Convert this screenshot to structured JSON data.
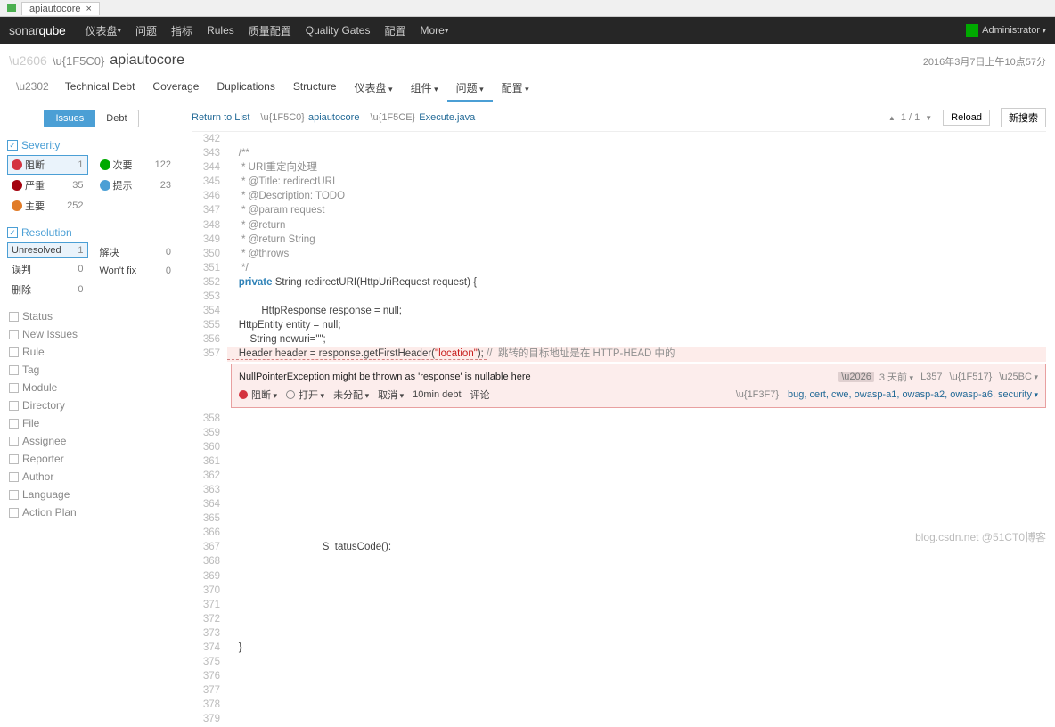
{
  "browser": {
    "tab_title": "apiautocore",
    "close": "×"
  },
  "nav": {
    "logo_a": "sonar",
    "logo_b": "qube",
    "items": [
      "仪表盘",
      "问题",
      "指标",
      "Rules",
      "质量配置",
      "Quality Gates",
      "配置",
      "More"
    ],
    "admin": "Administrator"
  },
  "project": {
    "name": "apiautocore",
    "timestamp": "2016年3月7日上午10点57分",
    "tabs": [
      "Technical Debt",
      "Coverage",
      "Duplications",
      "Structure",
      "仪表盘",
      "组件",
      "问题",
      "配置"
    ],
    "active_tab": 6
  },
  "sidebar": {
    "tabs": {
      "issues": "Issues",
      "debt": "Debt"
    },
    "severity": {
      "title": "Severity",
      "left": [
        {
          "icon": "sev-red",
          "label": "阻断",
          "count": "1",
          "sel": true
        },
        {
          "icon": "sev-darkred",
          "label": "严重",
          "count": "35"
        },
        {
          "icon": "sev-orange",
          "label": "主要",
          "count": "252"
        }
      ],
      "right": [
        {
          "icon": "sev-green",
          "label": "次要",
          "count": "122"
        },
        {
          "icon": "sev-cyan",
          "label": "提示",
          "count": "23"
        }
      ]
    },
    "resolution": {
      "title": "Resolution",
      "left": [
        {
          "label": "Unresolved",
          "count": "1",
          "sel": true
        },
        {
          "label": "误判",
          "count": "0"
        },
        {
          "label": "删除",
          "count": "0"
        }
      ],
      "right": [
        {
          "label": "解决",
          "count": "0"
        },
        {
          "label": "Won't fix",
          "count": "0"
        }
      ]
    },
    "closed": [
      "Status",
      "New Issues",
      "Rule",
      "Tag",
      "Module",
      "Directory",
      "File",
      "Assignee",
      "Reporter",
      "Author",
      "Language",
      "Action Plan"
    ]
  },
  "toolbar": {
    "return": "Return to List",
    "crumb_proj": "apiautocore",
    "crumb_file": "Execute.java",
    "pager_up": "▲",
    "pager_pos": "1 / 1",
    "pager_dn": "▼",
    "reload": "Reload",
    "search": "新搜索"
  },
  "code": {
    "lines": [
      {
        "n": "342",
        "t": ""
      },
      {
        "n": "343",
        "t": "    /**",
        "cls": "c-com"
      },
      {
        "n": "344",
        "t": "     * URI重定向处理",
        "cls": "c-com"
      },
      {
        "n": "345",
        "t": "     * @Title: redirectURI",
        "cls": "c-com"
      },
      {
        "n": "346",
        "t": "     * @Description: TODO",
        "cls": "c-com"
      },
      {
        "n": "347",
        "t": "     * @param request",
        "cls": "c-com"
      },
      {
        "n": "348",
        "t": "     * @return",
        "cls": "c-com"
      },
      {
        "n": "349",
        "t": "     * @return String",
        "cls": "c-com"
      },
      {
        "n": "350",
        "t": "     * @throws",
        "cls": "c-com"
      },
      {
        "n": "351",
        "t": "     */",
        "cls": "c-com"
      }
    ],
    "l352": {
      "n": "352",
      "kw": "private",
      "rest": " String redirectURI(HttpUriRequest request) {"
    },
    "plain": [
      {
        "n": "353",
        "t": ""
      },
      {
        "n": "354",
        "t": "            HttpResponse response = null;"
      },
      {
        "n": "355",
        "t": "    HttpEntity entity = null;"
      },
      {
        "n": "356",
        "t": "        String newuri=\"\";"
      }
    ],
    "l357": {
      "n": "357",
      "pre": "    Header header = response.getFirstHeader(",
      "str": "\"location\"",
      "post": "); ",
      "com": "//  跳转的目标地址是在 HTTP-HEAD 中的"
    }
  },
  "issue": {
    "message": "NullPointerException might be thrown as 'response' is nullable here",
    "age": "3 天前",
    "line": "L357",
    "sev": "阻断",
    "open": "打开",
    "assign": "未分配",
    "plan": "取消",
    "debt": "10min debt",
    "comment": "评论",
    "tags": "bug, cert, cwe, owasp-a1, owasp-a2, owasp-a6, security"
  },
  "after": {
    "start": 358,
    "end": 379,
    "blur_snip": "                                         tatusCode():",
    "brace": "    } ",
    "semi": "                                                                               ;"
  },
  "watermark": "blog.csdn.net  @51CT0博客",
  "chart_data": null
}
